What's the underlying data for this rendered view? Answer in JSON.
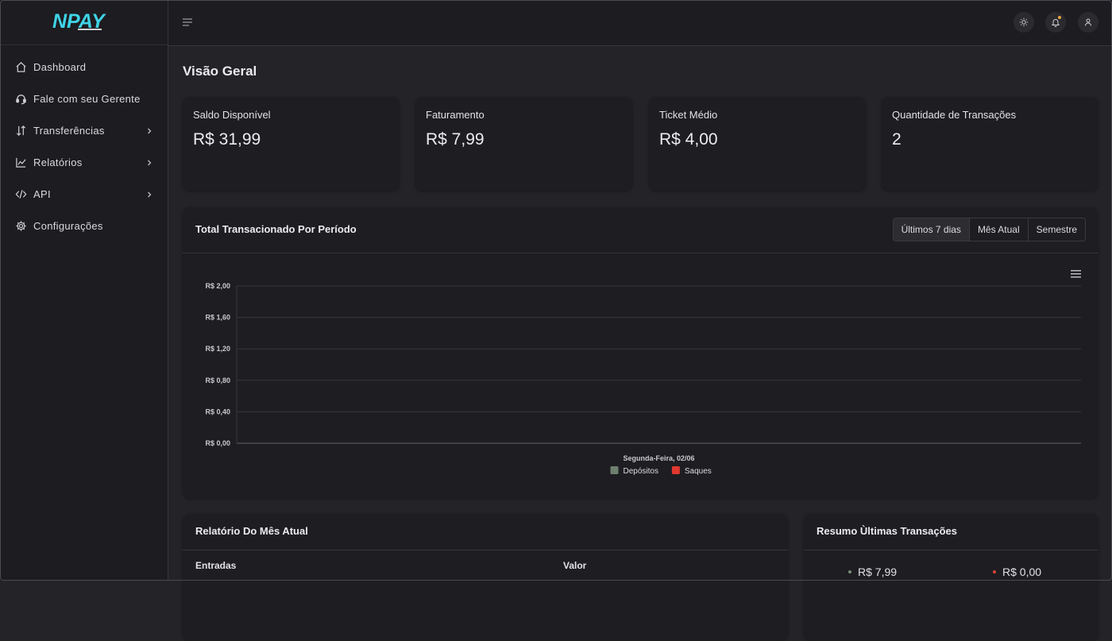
{
  "brand": {
    "logo_text": "NPAY"
  },
  "sidebar": {
    "items": [
      {
        "label": "Dashboard",
        "icon": "home-icon",
        "has_children": false
      },
      {
        "label": "Fale com seu Gerente",
        "icon": "headset-icon",
        "has_children": false
      },
      {
        "label": "Transferências",
        "icon": "transfer-arrows-icon",
        "has_children": true
      },
      {
        "label": "Relatórios",
        "icon": "line-chart-icon",
        "has_children": true
      },
      {
        "label": "API",
        "icon": "code-icon",
        "has_children": true
      },
      {
        "label": "Configurações",
        "icon": "gear-icon",
        "has_children": false
      }
    ]
  },
  "topbar": {
    "icons": [
      "menu-icon",
      "sun-icon",
      "bell-icon",
      "user-icon"
    ],
    "notification_dot_color": "#e9a23b"
  },
  "main": {
    "title": "Visão Geral",
    "stats": [
      {
        "label": "Saldo Disponível",
        "value": "R$ 31,99"
      },
      {
        "label": "Faturamento",
        "value": "R$ 7,99"
      },
      {
        "label": "Ticket Médio",
        "value": "R$ 4,00"
      },
      {
        "label": "Quantidade de Transações",
        "value": "2"
      }
    ],
    "chart_card": {
      "title": "Total Transacionado Por Período",
      "periods": [
        {
          "label": "Últimos 7 dias",
          "active": true
        },
        {
          "label": "Mês Atual",
          "active": false
        },
        {
          "label": "Semestre",
          "active": false
        }
      ]
    },
    "report": {
      "title": "Relatório Do Mês Atual",
      "columns": [
        "Entradas",
        "Valor"
      ]
    },
    "summary": {
      "title": "Resumo Ùltimas Transações",
      "items": [
        {
          "value": "R$ 7,99",
          "color": "#7d8b7f"
        },
        {
          "value": "R$ 0,00",
          "color": "#e0433a"
        }
      ]
    }
  },
  "chart_data": {
    "type": "bar",
    "categories": [
      "Segunda-Feira, 02/06"
    ],
    "series": [
      {
        "name": "Depósitos",
        "values": [
          0
        ],
        "color": "#6f7f6f"
      },
      {
        "name": "Saques",
        "values": [
          0
        ],
        "color": "#e0382f"
      }
    ],
    "yticks": [
      "R$ 0,00",
      "R$ 0,40",
      "R$ 0,80",
      "R$ 1,20",
      "R$ 1,60",
      "R$ 2,00"
    ],
    "ylim": [
      0,
      2
    ],
    "grid": true,
    "legend": "bottom-center"
  }
}
